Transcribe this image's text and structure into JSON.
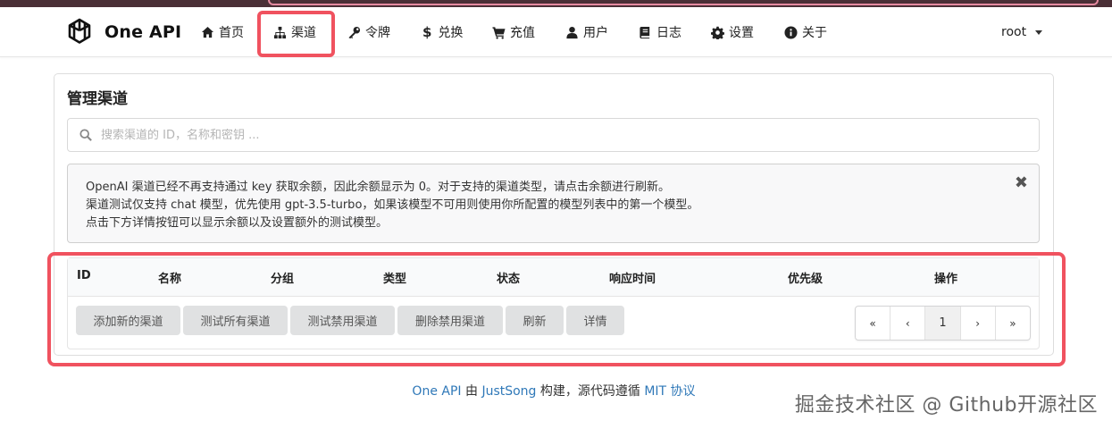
{
  "brand": {
    "name": "One API"
  },
  "nav": {
    "items": [
      {
        "label": "首页",
        "icon": "home-icon"
      },
      {
        "label": "渠道",
        "icon": "sitemap-icon"
      },
      {
        "label": "令牌",
        "icon": "key-icon"
      },
      {
        "label": "兑换",
        "icon": "dollar-icon",
        "glyph": "$"
      },
      {
        "label": "充值",
        "icon": "cart-icon"
      },
      {
        "label": "用户",
        "icon": "user-icon"
      },
      {
        "label": "日志",
        "icon": "book-icon"
      },
      {
        "label": "设置",
        "icon": "gear-icon"
      },
      {
        "label": "关于",
        "icon": "info-icon"
      }
    ],
    "user": "root"
  },
  "page": {
    "title": "管理渠道",
    "search_placeholder": "搜索渠道的 ID，名称和密钥 ...",
    "notice": [
      "OpenAI 渠道已经不再支持通过 key 获取余额，因此余额显示为 0。对于支持的渠道类型，请点击余额进行刷新。",
      "渠道测试仅支持 chat 模型，优先使用 gpt-3.5-turbo，如果该模型不可用则使用你所配置的模型列表中的第一个模型。",
      "点击下方详情按钮可以显示余额以及设置额外的测试模型。"
    ],
    "notice_close": "✖"
  },
  "table": {
    "columns": [
      "ID",
      "名称",
      "分组",
      "类型",
      "状态",
      "响应时间",
      "优先级",
      "操作"
    ],
    "rows": []
  },
  "actions": {
    "add": "添加新的渠道",
    "test_all": "测试所有渠道",
    "test_disabled": "测试禁用渠道",
    "delete_disabled": "删除禁用渠道",
    "refresh": "刷新",
    "details": "详情"
  },
  "pagination": {
    "first": "«",
    "prev": "‹",
    "current": "1",
    "next": "›",
    "last": "»"
  },
  "footer": {
    "app": "One API",
    "by": "由",
    "author": "JustSong",
    "mid": "构建，源代码遵循",
    "license": "MIT 协议"
  },
  "watermark": "掘金技术社区 @ Github开源社区",
  "colors": {
    "highlight": "#f0525f",
    "link": "#2f78b8",
    "button_bg": "#e0e1e2"
  }
}
